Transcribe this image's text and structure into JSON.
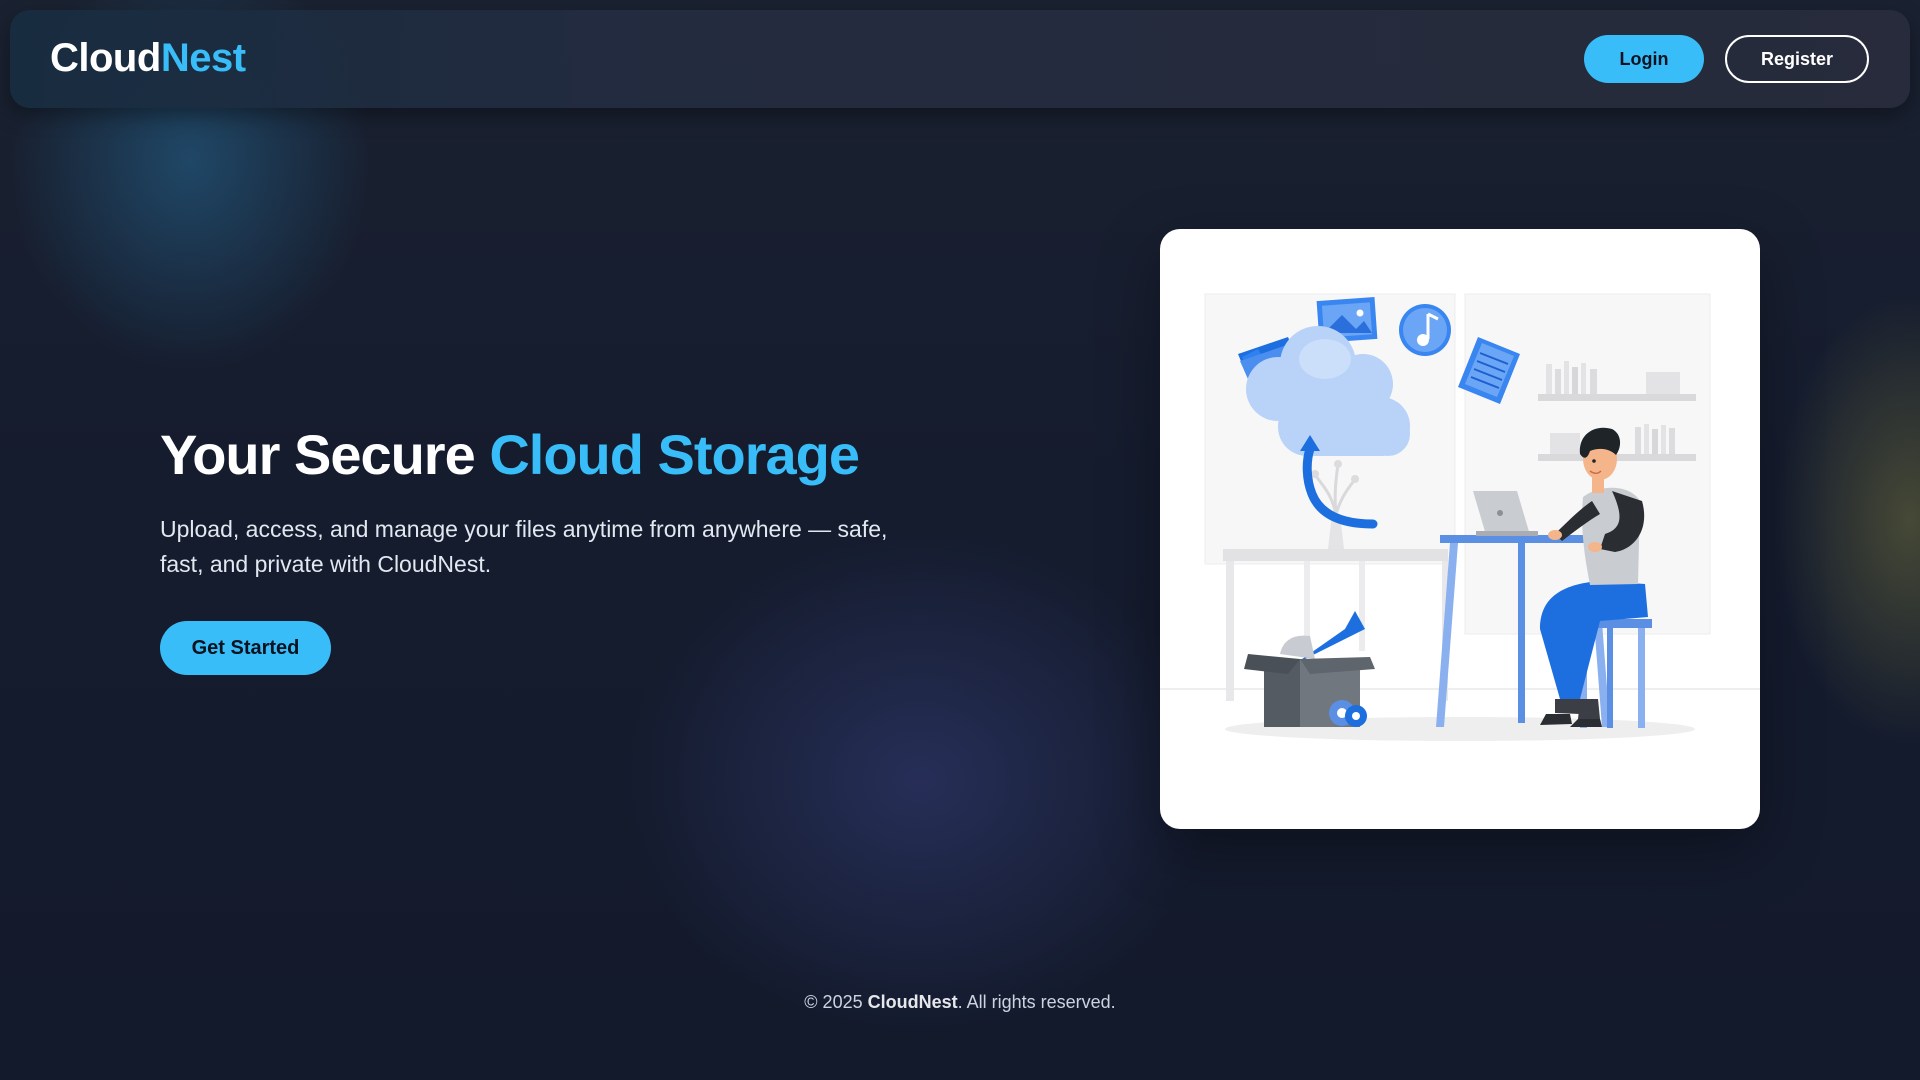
{
  "brand": {
    "name_part1": "Cloud",
    "name_part2": "Nest",
    "accent_color": "#38bdf8"
  },
  "nav": {
    "login_label": "Login",
    "register_label": "Register"
  },
  "hero": {
    "title_part1": "Your Secure ",
    "title_part2": "Cloud Storage",
    "subtitle": "Upload, access, and manage your files anytime from anywhere — safe, fast, and private with CloudNest.",
    "cta_label": "Get Started"
  },
  "illustration": {
    "icons": [
      "folder-icon",
      "image-icon",
      "music-note-icon",
      "document-icon",
      "cloud-icon",
      "upload-arrow-icon",
      "laptop-icon"
    ]
  },
  "footer": {
    "copyright": "© 2025",
    "brand": "CloudNest",
    "rights": ". All rights reserved."
  },
  "colors": {
    "background": "#151c2e",
    "accent": "#38bdf8",
    "card": "#ffffff"
  }
}
